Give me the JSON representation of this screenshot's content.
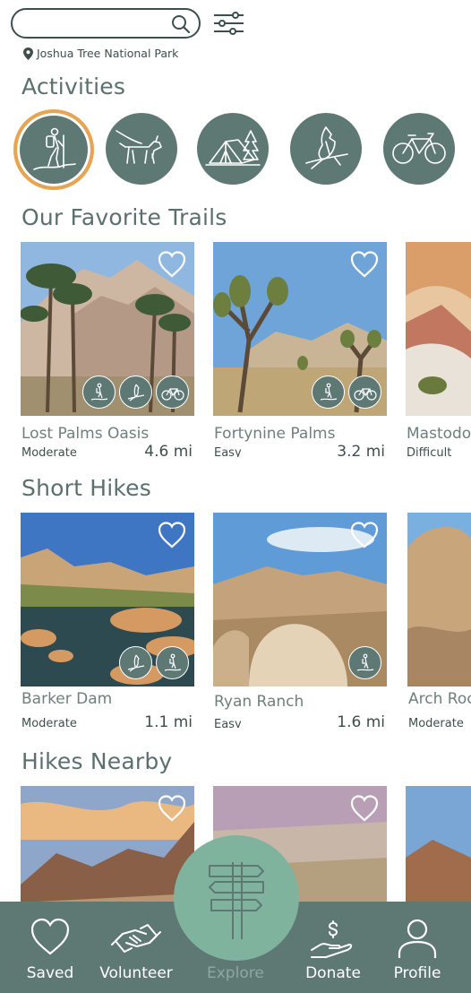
{
  "search": {
    "placeholder": ""
  },
  "location": {
    "label": "Joshua Tree National Park"
  },
  "sections": {
    "activities": "Activities",
    "favorites": "Our Favorite Trails",
    "short": "Short Hikes",
    "nearby": "Hikes Nearby"
  },
  "activities": [
    {
      "icon": "hiker-icon",
      "selected": true
    },
    {
      "icon": "dog-walking-icon",
      "selected": false
    },
    {
      "icon": "camping-tent-icon",
      "selected": false
    },
    {
      "icon": "bird-watching-icon",
      "selected": false
    },
    {
      "icon": "bicycle-icon",
      "selected": false
    }
  ],
  "favorites": [
    {
      "name": "Lost Palms Oasis",
      "difficulty": "Moderate",
      "distance": "4.6 mi"
    },
    {
      "name": "Fortynine Palms",
      "difficulty": "Easy",
      "distance": "3.2 mi"
    },
    {
      "name": "Mastodon",
      "difficulty": "Difficult",
      "distance": ""
    }
  ],
  "short": [
    {
      "name": "Barker Dam",
      "difficulty": "Moderate",
      "distance": "1.1 mi"
    },
    {
      "name": "Ryan Ranch",
      "difficulty": "Easy",
      "distance": "1.6 mi"
    },
    {
      "name": "Arch Rock",
      "difficulty": "Moderate",
      "distance": ""
    }
  ],
  "nav": {
    "saved": "Saved",
    "volunteer": "Volunteer",
    "explore": "Explore",
    "donate": "Donate",
    "profile": "Profile"
  },
  "colors": {
    "accent": "#5e7874",
    "selected_ring": "#e7a552",
    "explore": "#7fb39e"
  }
}
